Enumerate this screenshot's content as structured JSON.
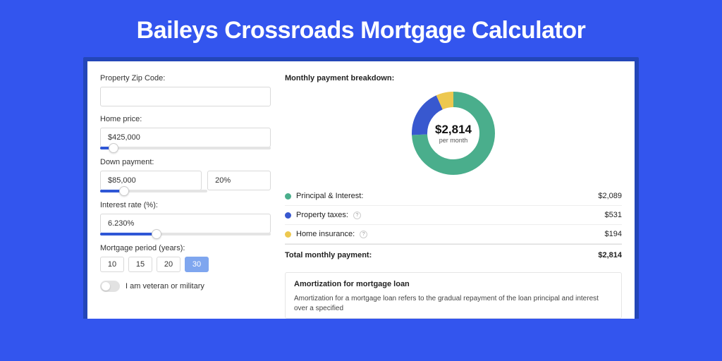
{
  "title": "Baileys Crossroads Mortgage Calculator",
  "form": {
    "zip": {
      "label": "Property Zip Code:",
      "value": ""
    },
    "price": {
      "label": "Home price:",
      "value": "$425,000",
      "slider_pct": 8
    },
    "down": {
      "label": "Down payment:",
      "amount": "$85,000",
      "pct": "20%",
      "slider_pct": 22
    },
    "rate": {
      "label": "Interest rate (%):",
      "value": "6.230%",
      "slider_pct": 33
    },
    "period": {
      "label": "Mortgage period (years):",
      "options": [
        "10",
        "15",
        "20",
        "30"
      ],
      "selected": "30"
    },
    "veteran": {
      "label": "I am veteran or military"
    }
  },
  "breakdown": {
    "title": "Monthly payment breakdown:",
    "center_amount": "$2,814",
    "center_label": "per month",
    "items": [
      {
        "label": "Principal & Interest:",
        "value": "$2,089",
        "color": "#4aae8c",
        "info": false,
        "pct": 74.2
      },
      {
        "label": "Property taxes:",
        "value": "$531",
        "color": "#3858cf",
        "info": true,
        "pct": 18.9
      },
      {
        "label": "Home insurance:",
        "value": "$194",
        "color": "#edc84f",
        "info": true,
        "pct": 6.9
      }
    ],
    "total_label": "Total monthly payment:",
    "total_value": "$2,814"
  },
  "amort": {
    "title": "Amortization for mortgage loan",
    "text": "Amortization for a mortgage loan refers to the gradual repayment of the loan principal and interest over a specified"
  },
  "chart_data": {
    "type": "pie",
    "title": "Monthly payment breakdown",
    "series": [
      {
        "name": "Principal & Interest",
        "value": 2089,
        "color": "#4aae8c"
      },
      {
        "name": "Property taxes",
        "value": 531,
        "color": "#3858cf"
      },
      {
        "name": "Home insurance",
        "value": 194,
        "color": "#edc84f"
      }
    ],
    "total": 2814,
    "unit": "USD per month"
  }
}
